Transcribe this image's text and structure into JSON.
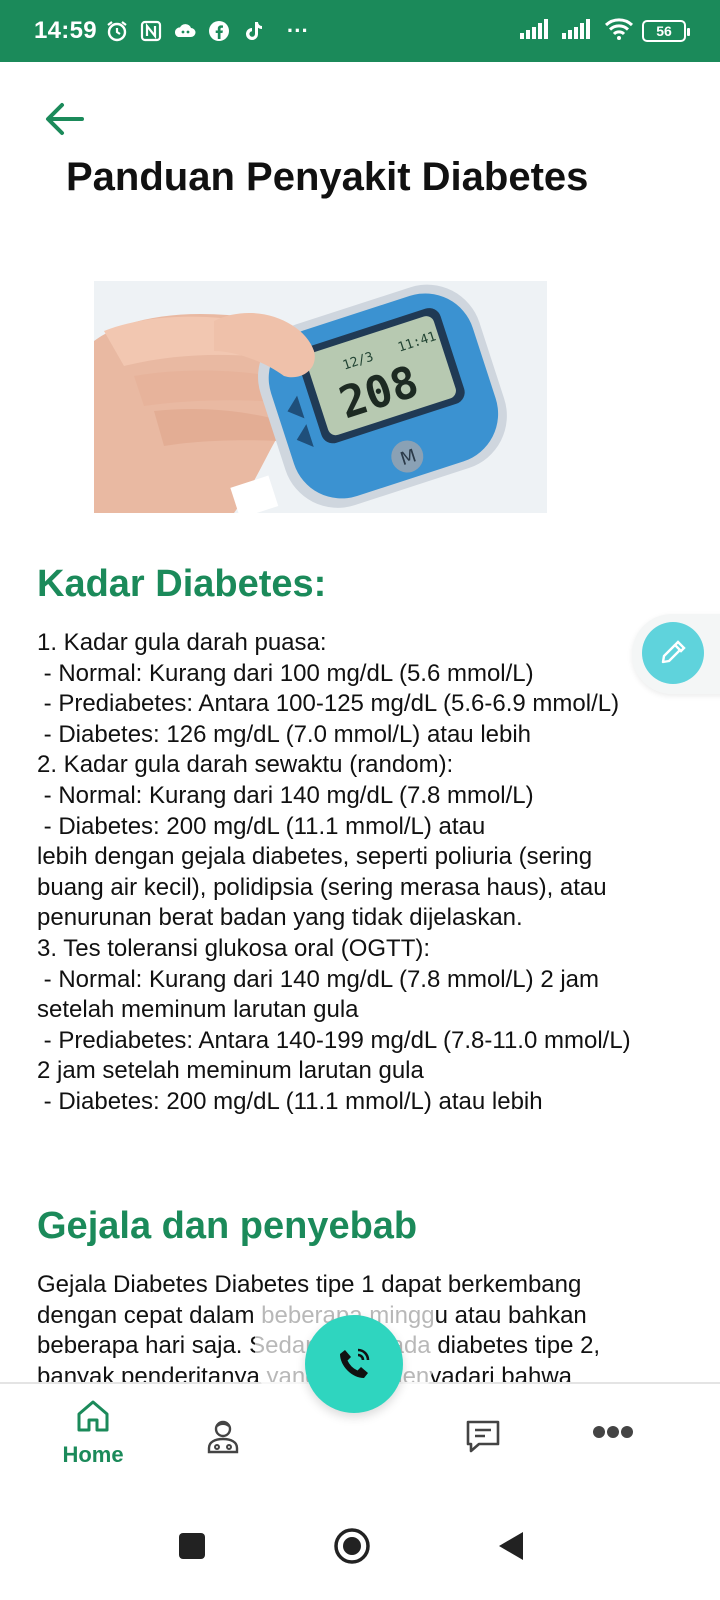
{
  "status_bar": {
    "time": "14:59",
    "left_icons": [
      "alarm-icon",
      "nfc-icon",
      "cloud-game-icon",
      "facebook-icon",
      "tiktok-icon",
      "more-dots-icon"
    ],
    "more_label": "···",
    "battery_level": "56"
  },
  "header": {
    "title": "Panduan Penyakit Diabetes"
  },
  "hero_image": {
    "meter_reading": "208",
    "meter_date": "12/3",
    "meter_time": "11:41",
    "meter_button": "M"
  },
  "sections": {
    "kadar": {
      "heading": "Kadar Diabetes:",
      "text": "1. Kadar gula darah puasa:\n - Normal: Kurang dari 100 mg/dL (5.6 mmol/L)\n - Prediabetes: Antara 100-125 mg/dL (5.6-6.9 mmol/L)\n - Diabetes: 126 mg/dL (7.0 mmol/L) atau lebih\n2. Kadar gula darah sewaktu (random):\n - Normal: Kurang dari 140 mg/dL (7.8 mmol/L)\n - Diabetes: 200 mg/dL (11.1 mmol/L) atau\nlebih dengan gejala diabetes, seperti poliuria (sering buang air kecil), polidipsia (sering merasa haus), atau penurunan berat badan yang tidak dijelaskan.\n3. Tes toleransi glukosa oral (OGTT):\n - Normal: Kurang dari 140 mg/dL (7.8 mmol/L) 2 jam setelah meminum larutan gula\n - Prediabetes: Antara 140-199 mg/dL (7.8-11.0 mmol/L) 2 jam setelah meminum larutan gula\n - Diabetes: 200 mg/dL (11.1 mmol/L) atau lebih"
    },
    "gejala": {
      "heading": "Gejala dan penyebab",
      "text": "Gejala Diabetes Diabetes tipe 1 dapat berkembang dengan cepat dalam beberapa minggu atau bahkan beberapa hari saja. Sedangkan pada diabetes tipe 2, banyak penderitanya yang tidak menyadari bahwa mereka menderita diabetes"
    }
  },
  "bottom_nav": {
    "home_label": "Home",
    "active_color": "#1b8a5a",
    "items": [
      "home-icon",
      "doctor-icon",
      "call-icon",
      "chat-icon",
      "more-icon"
    ]
  },
  "colors": {
    "primary": "#1b8a5a",
    "fab_edit": "#5fd3dc",
    "fab_call": "#2fd5bf"
  }
}
